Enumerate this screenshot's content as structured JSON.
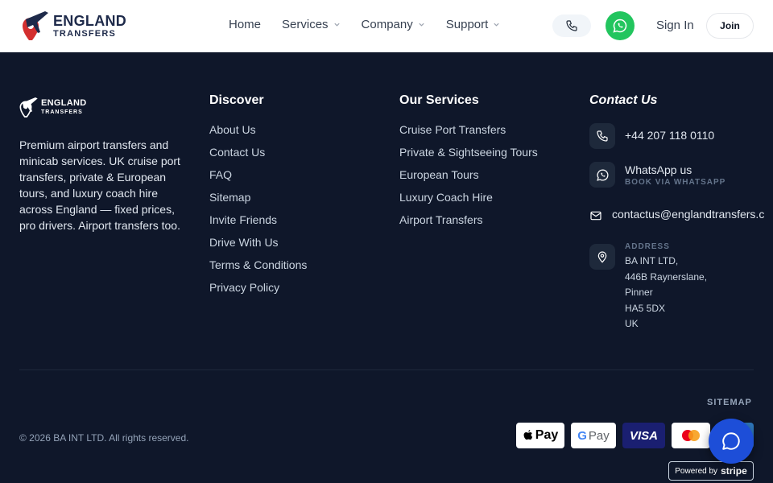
{
  "header": {
    "logo_line1": "ENGLAND",
    "logo_line2": "TRANSFERS",
    "nav": [
      {
        "label": "Home",
        "has_chevron": false
      },
      {
        "label": "Services",
        "has_chevron": true
      },
      {
        "label": "Company",
        "has_chevron": true
      },
      {
        "label": "Support",
        "has_chevron": true
      }
    ],
    "phone_icon": "phone-icon",
    "whatsapp_icon": "whatsapp-icon",
    "signin_label": "Sign In",
    "join_label": "Join"
  },
  "footer": {
    "brand_line1": "ENGLAND",
    "brand_line2": "TRANSFERS",
    "about": "Premium airport transfers and minicab services. UK cruise port transfers, private & European tours, and luxury coach hire across England — fixed prices, pro drivers. Airport transfers too.",
    "discover": {
      "title": "Discover",
      "links": [
        "About Us",
        "Contact Us",
        "FAQ",
        "Sitemap",
        "Invite Friends",
        "Drive With Us",
        "Terms & Conditions",
        "Privacy Policy"
      ]
    },
    "services": {
      "title": "Our Services",
      "links": [
        "Cruise Port Transfers",
        "Private & Sightseeing Tours",
        "European Tours",
        "Luxury Coach Hire",
        "Airport Transfers"
      ]
    },
    "contact": {
      "title": "Contact Us",
      "phone": "+44 207 118 0110",
      "whatsapp": "WhatsApp us",
      "whatsapp_sub": "BOOK VIA WHATSAPP",
      "email": "contactus@englandtransfers.c",
      "address_label": "ADDRESS",
      "address_lines": [
        "BA INT LTD,",
        "446B Raynerslane,",
        "Pinner",
        "HA5 5DX",
        "UK"
      ]
    },
    "sitemap_label": "SITEMAP",
    "copyright": "© 2026 BA INT LTD. All rights reserved.",
    "payments": {
      "apple": "Pay",
      "google": "Pay",
      "visa": "VISA"
    },
    "stripe_prefix": "Powered by",
    "stripe_brand": "stripe"
  },
  "colors": {
    "footer_bg": "#0f172a",
    "whatsapp": "#22c55e",
    "chat": "#1d4ed8",
    "logo_red": "#d32f2f"
  }
}
